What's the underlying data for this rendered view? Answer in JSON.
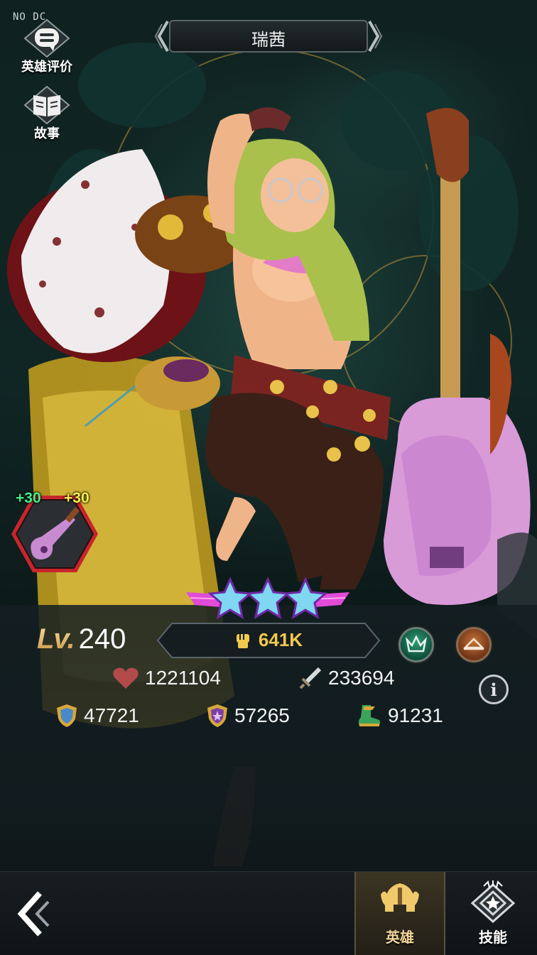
{
  "debug_tag": "NO DC",
  "side_menu": [
    {
      "label": "英雄评价",
      "icon": "chat-bubble-icon"
    },
    {
      "label": "故事",
      "icon": "book-icon"
    }
  ],
  "hero": {
    "name": "瑞茜",
    "level_prefix": "Lv.",
    "level": "240",
    "power": "641K",
    "stars": 3
  },
  "equipment": {
    "item": "guitar",
    "bonus_left": "+30",
    "bonus_right": "+30"
  },
  "stats": {
    "hp": "1221104",
    "attack": "233694",
    "defense": "47721",
    "magic_defense": "57265",
    "speed": "91231"
  },
  "bottom_nav": {
    "hero_tab": "英雄",
    "skill_tab": "技能",
    "active": "英雄"
  },
  "colors": {
    "power_text": "#f1c94c",
    "level_gold": "#e9c67d",
    "equip_bonus_green": "#3ef08a",
    "equip_bonus_yellow": "#f1ef4a",
    "star_pink": "#e24bd8"
  }
}
